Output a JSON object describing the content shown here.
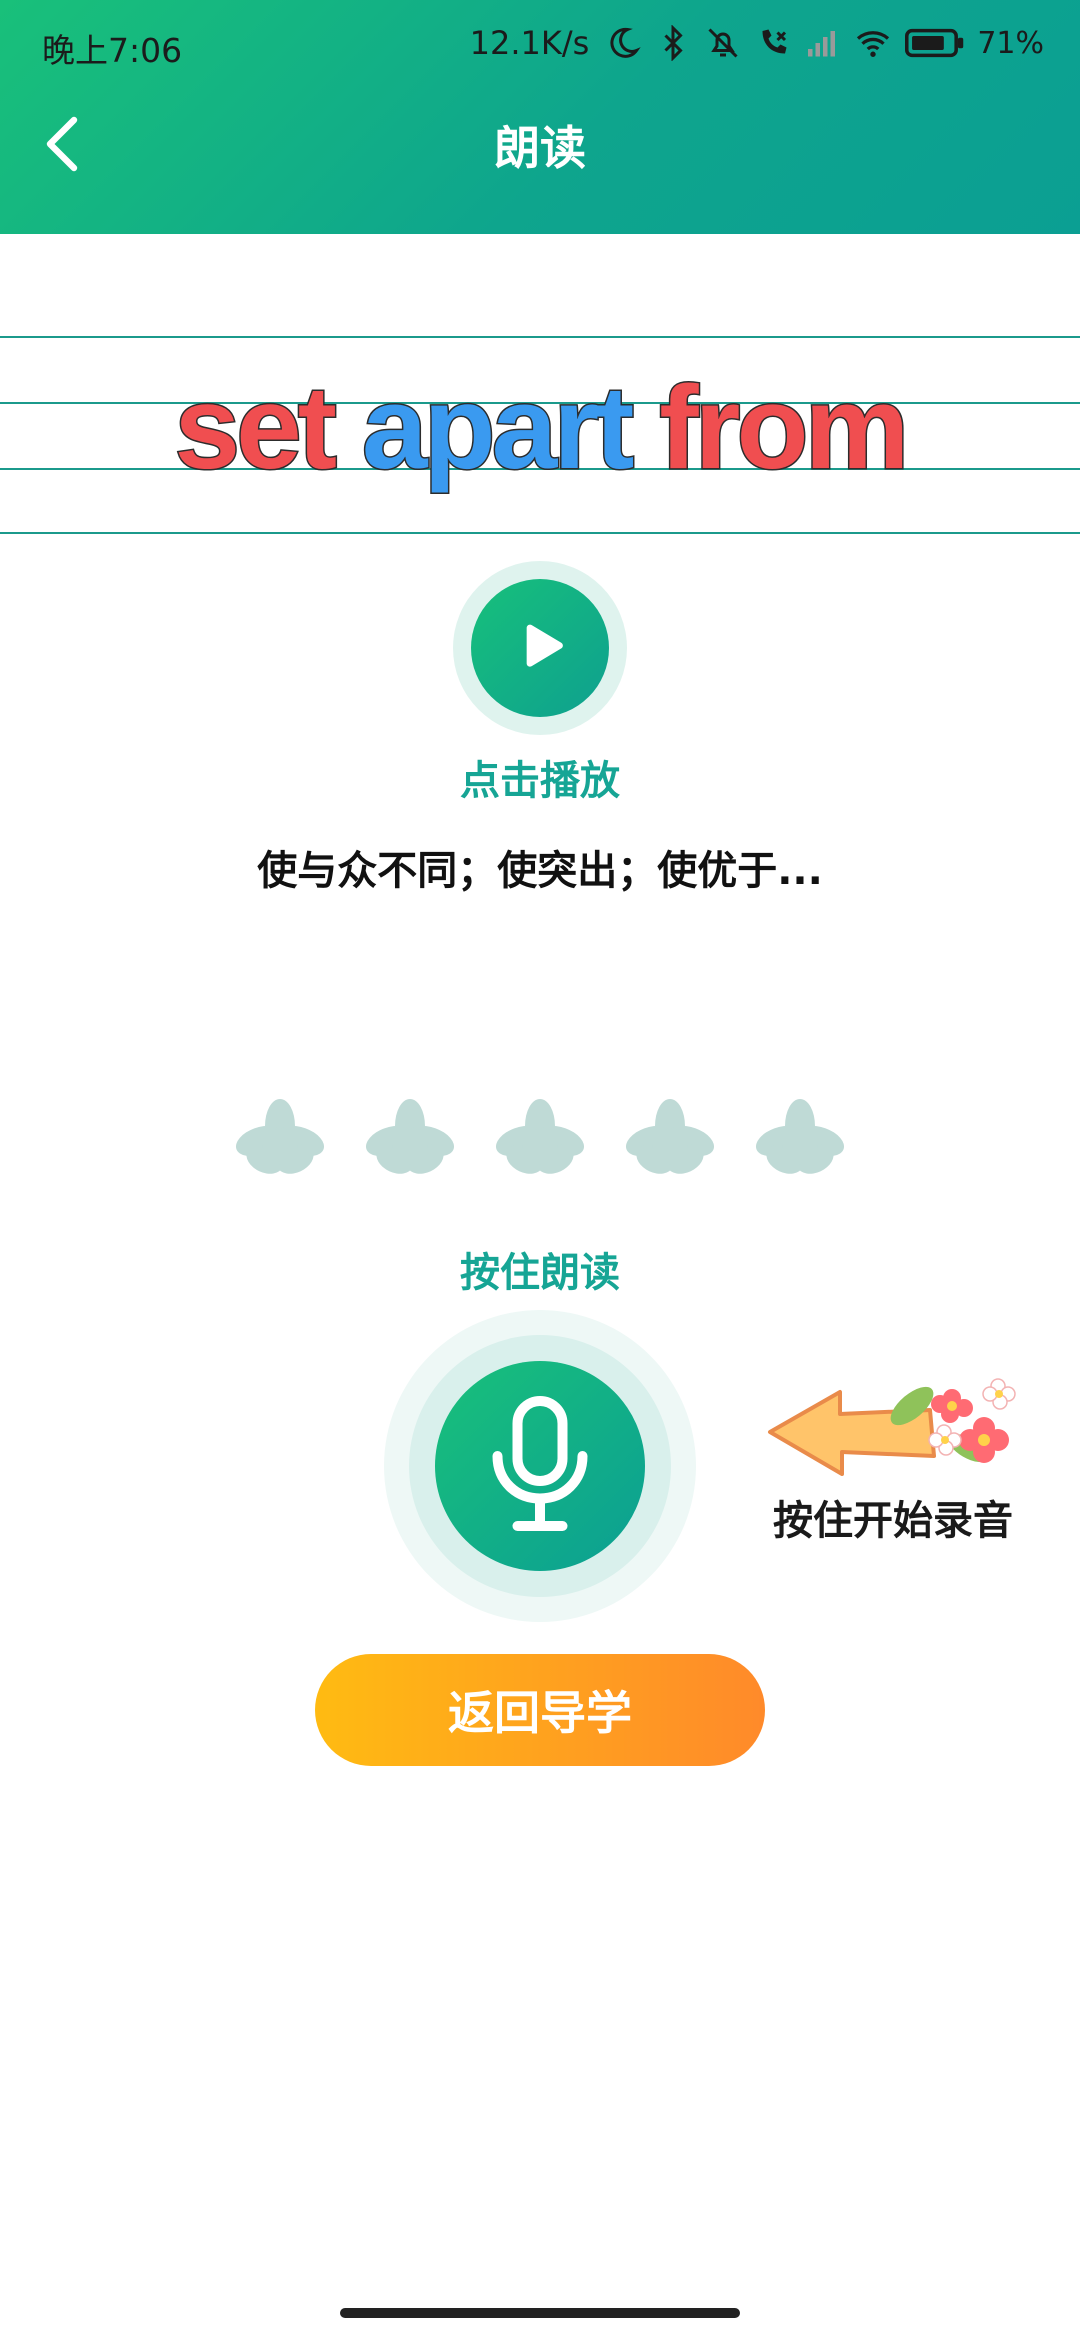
{
  "status_bar": {
    "time": "晚上7:06",
    "net_speed": "12.1K/s",
    "battery_percent": "71%",
    "icons": [
      "moon-icon",
      "bluetooth-icon",
      "mute-bell-icon",
      "missed-call-icon",
      "signal-icon",
      "wifi-icon",
      "battery-icon"
    ]
  },
  "header": {
    "title": "朗读",
    "back_icon": "chevron-left-icon"
  },
  "word": {
    "parts": [
      "set",
      "apart",
      "from"
    ],
    "colors": [
      "#f04e50",
      "#3a9af0",
      "#f04e50"
    ]
  },
  "play": {
    "label": "点击播放",
    "icon": "play-icon"
  },
  "meaning": "使与众不同；使突出；使优于...",
  "rating": {
    "max": 5,
    "value": 0,
    "icon": "flower-icon"
  },
  "record": {
    "label": "按住朗读",
    "icon": "microphone-icon",
    "hint": "按住开始录音"
  },
  "return_button": {
    "label": "返回导学"
  },
  "colors": {
    "primary": "#13b08a",
    "accent_text": "#16a595",
    "button_start": "#ffbb12",
    "button_end": "#ff8a2a",
    "flower_inactive": "#bfdad6"
  }
}
